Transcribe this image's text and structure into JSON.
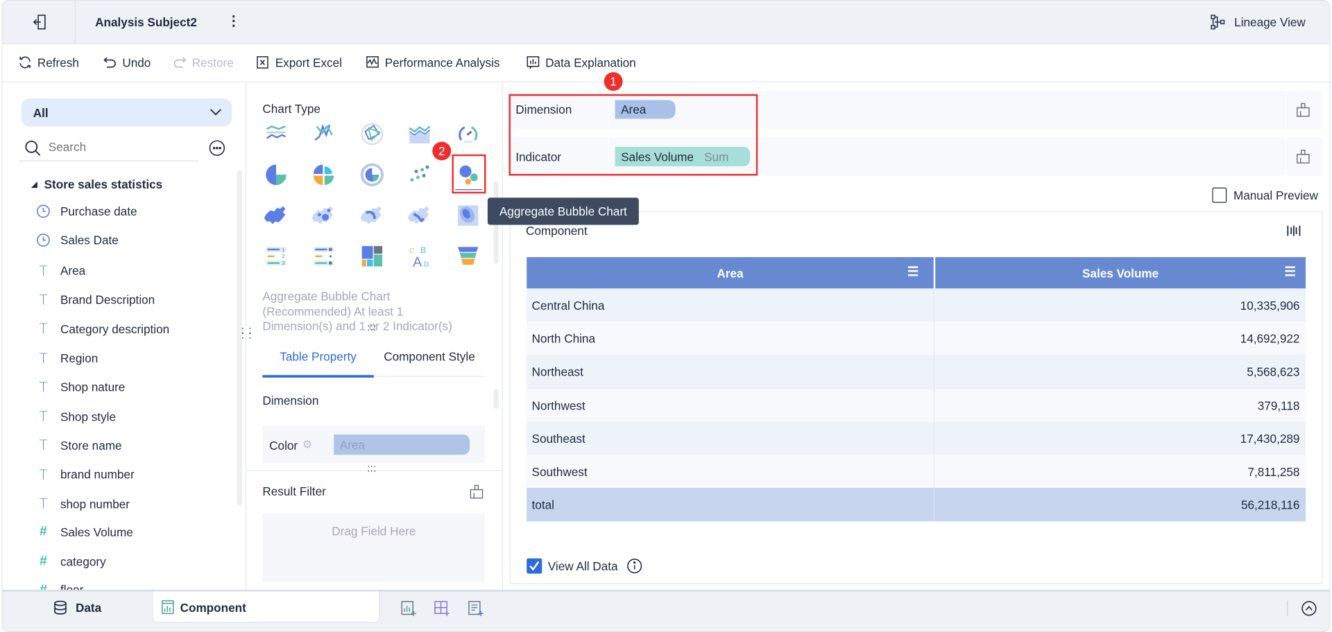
{
  "header": {
    "title": "Analysis Subject2",
    "lineage_view": "Lineage View"
  },
  "toolbar": {
    "refresh": "Refresh",
    "undo": "Undo",
    "restore": "Restore",
    "export_excel": "Export Excel",
    "performance_analysis": "Performance Analysis",
    "data_explanation": "Data Explanation"
  },
  "left": {
    "filter_select": "All",
    "search_placeholder": "Search",
    "group": "Store sales statistics",
    "fields": [
      {
        "label": "Purchase date",
        "type": "date"
      },
      {
        "label": "Sales Date",
        "type": "date"
      },
      {
        "label": "Area",
        "type": "text"
      },
      {
        "label": "Brand Description",
        "type": "text"
      },
      {
        "label": "Category description",
        "type": "text"
      },
      {
        "label": "Region",
        "type": "text"
      },
      {
        "label": "Shop nature",
        "type": "text"
      },
      {
        "label": "Shop style",
        "type": "text"
      },
      {
        "label": "Store name",
        "type": "text"
      },
      {
        "label": "brand number",
        "type": "text"
      },
      {
        "label": "shop number",
        "type": "text"
      },
      {
        "label": "Sales Volume",
        "type": "number"
      },
      {
        "label": "category",
        "type": "number"
      },
      {
        "label": "floor",
        "type": "number"
      }
    ]
  },
  "middle": {
    "chart_type_label": "Chart Type",
    "selected_chart": "aggregate-bubble",
    "tooltip": "Aggregate Bubble Chart",
    "description": "Aggregate Bubble Chart (Recommended) At least 1 Dimension(s) and 1 or 2 Indicator(s)",
    "tabs": [
      {
        "label": "Table Property",
        "active": true
      },
      {
        "label": "Component Style",
        "active": false
      }
    ],
    "dimension_label": "Dimension",
    "color_label": "Color",
    "color_field": "Area",
    "result_filter": "Result Filter",
    "drag_placeholder": "Drag Field Here"
  },
  "right": {
    "dimension_label": "Dimension",
    "dimension_field": "Area",
    "indicator_label": "Indicator",
    "indicator_field": "Sales Volume",
    "indicator_agg": "Sum",
    "manual_preview": "Manual Preview",
    "manual_preview_checked": false,
    "component_title": "Component",
    "table": {
      "columns": [
        "Area",
        "Sales Volume"
      ],
      "rows": [
        [
          "Central China",
          "10,335,906"
        ],
        [
          "North China",
          "14,692,922"
        ],
        [
          "Northeast",
          "5,568,623"
        ],
        [
          "Northwest",
          "379,118"
        ],
        [
          "Southeast",
          "17,430,289"
        ],
        [
          "Southwest",
          "7,811,258"
        ]
      ],
      "total": [
        "total",
        "56,218,116"
      ]
    },
    "view_all_data": "View All Data",
    "view_all_checked": true
  },
  "annotations": [
    "1",
    "2"
  ],
  "bottom": {
    "data_tab": "Data",
    "component_tab": "Component"
  },
  "colors": {
    "accent": "#2f6bdc",
    "table_header": "#6789d1",
    "total_row": "#c7d5ef",
    "dimension_chip": "#a9c0e8",
    "indicator_chip": "#a8ded8",
    "highlight": "#ee2d2d",
    "tooltip": "#3d4a5f"
  }
}
